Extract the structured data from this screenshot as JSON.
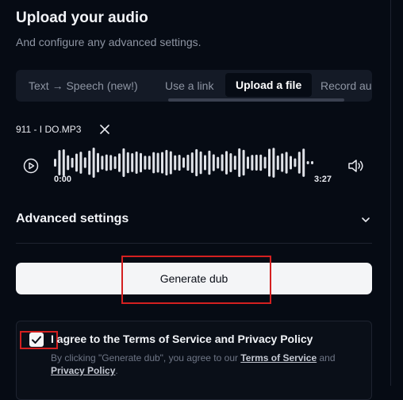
{
  "header": {
    "title": "Upload your audio",
    "subtitle": "And configure any advanced settings."
  },
  "tabs": [
    {
      "label": "Text → Speech (new!)",
      "active": false
    },
    {
      "label": "Use a link",
      "active": false
    },
    {
      "label": "Upload a file",
      "active": true
    },
    {
      "label": "Record au",
      "active": false
    }
  ],
  "player": {
    "file_name": "911 - I DO.MP3",
    "time_start": "0:00",
    "time_end": "3:27"
  },
  "advanced": {
    "label": "Advanced settings"
  },
  "generate": {
    "label": "Generate dub"
  },
  "agreement": {
    "title": "I agree to the Terms of Service and Privacy Policy",
    "prefix": "By clicking \"Generate dub\", you agree to our ",
    "terms_link": "Terms of Service",
    "and": " and ",
    "privacy_link": "Privacy Policy",
    "suffix": "."
  },
  "colors": {
    "background": "#060b14",
    "highlight": "#d42020",
    "button": "#f4f5f7"
  }
}
